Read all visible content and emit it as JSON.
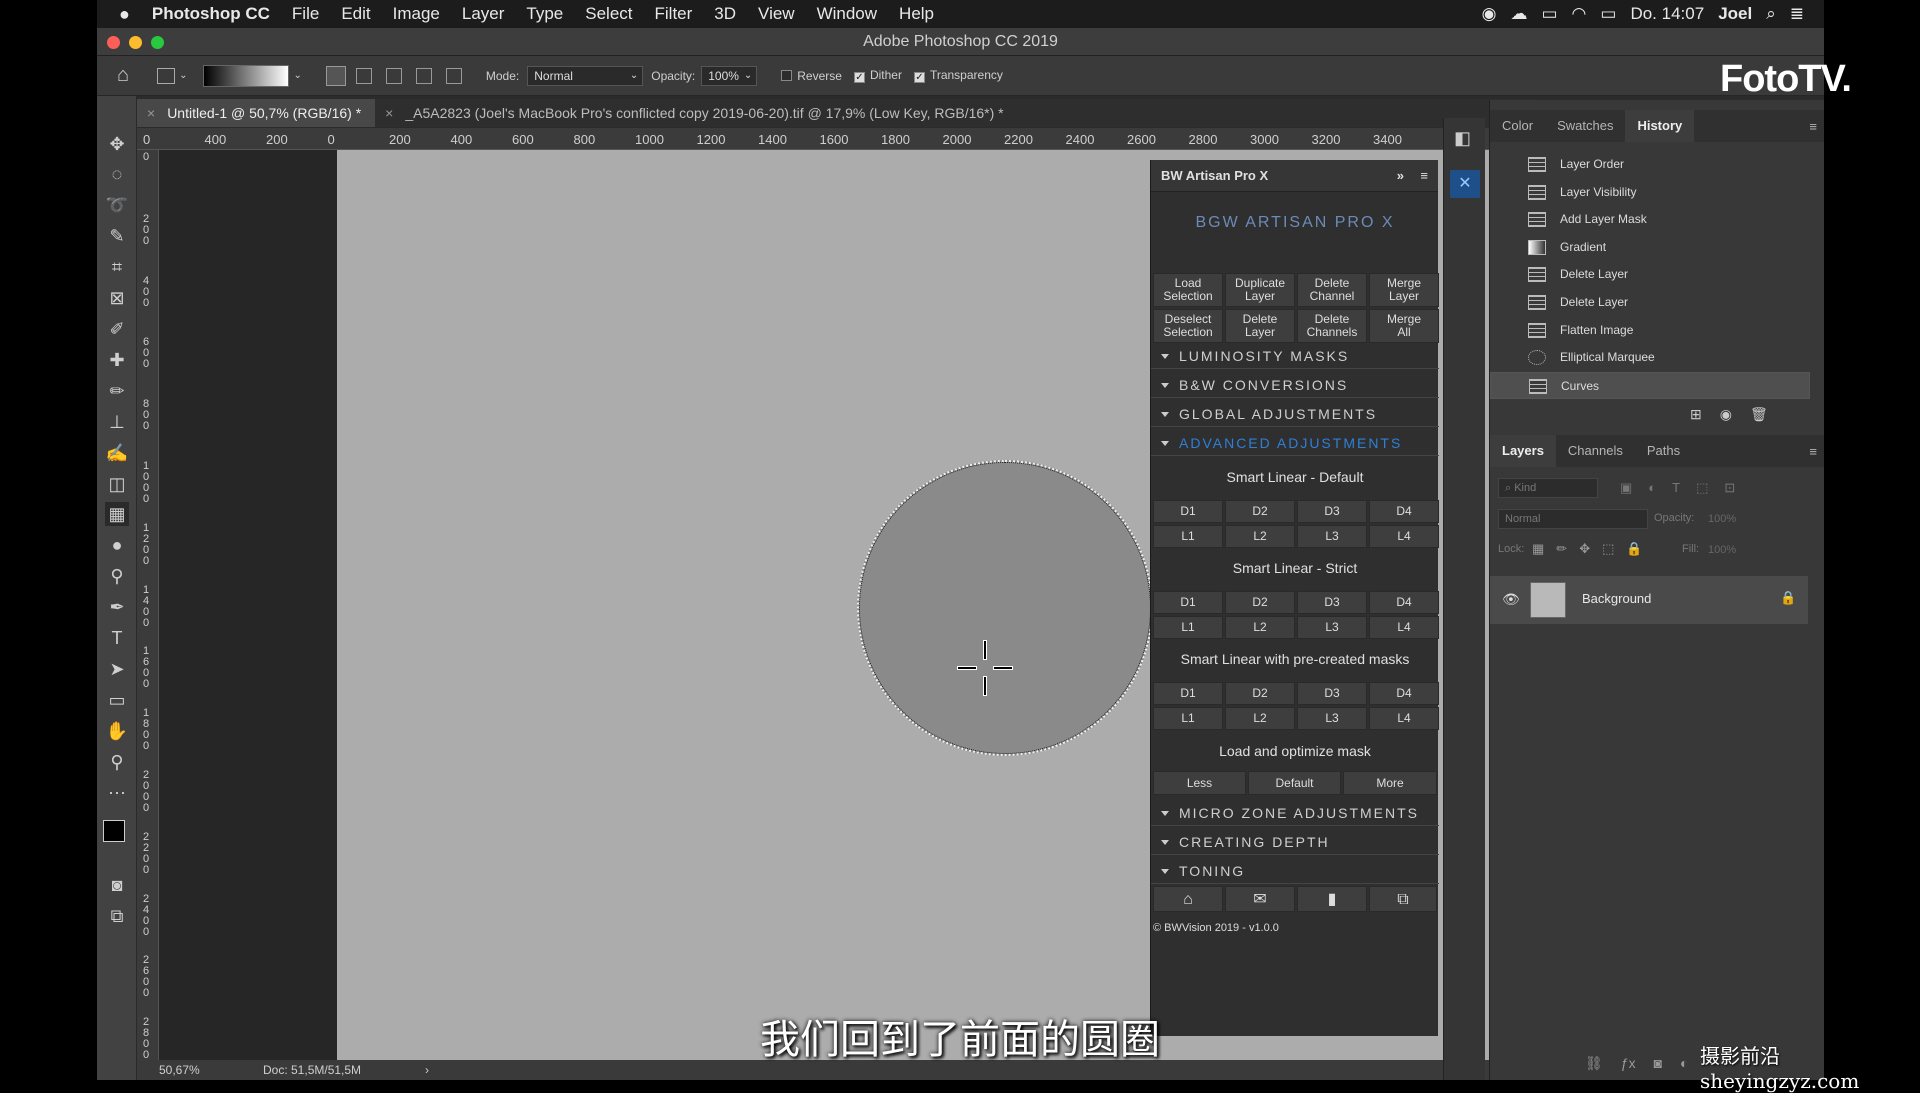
{
  "menubar": {
    "apple": "",
    "app": "Photoshop CC",
    "items": [
      "File",
      "Edit",
      "Image",
      "Layer",
      "Type",
      "Select",
      "Filter",
      "3D",
      "View",
      "Window",
      "Help"
    ],
    "clock": "Do. 14:07",
    "user": "Joel"
  },
  "window_title": "Adobe Photoshop CC 2019",
  "options": {
    "mode_label": "Mode:",
    "mode_value": "Normal",
    "opacity_label": "Opacity:",
    "opacity_value": "100%",
    "reverse_label": "Reverse",
    "reverse_checked": false,
    "dither_label": "Dither",
    "dither_checked": true,
    "transparency_label": "Transparency",
    "transparency_checked": true
  },
  "doc_tabs": [
    {
      "label": "Untitled-1 @ 50,7% (RGB/16) *",
      "active": true
    },
    {
      "label": "_A5A2823 (Joel's MacBook Pro's conflicted copy 2019-06-20).tif @ 17,9% (Low Key, RGB/16*) *",
      "active": false
    }
  ],
  "ruler_h": [
    "0",
    "400",
    "200",
    "0",
    "200",
    "400",
    "600",
    "800",
    "1000",
    "1200",
    "1400",
    "1600",
    "1800",
    "2000",
    "2200",
    "2400",
    "2600",
    "2800",
    "3000",
    "3200",
    "3400"
  ],
  "ruler_v": [
    "0",
    "2 0 0",
    "4 0 0",
    "6 0 0",
    "8 0 0",
    "1 0 0 0",
    "1 2 0 0",
    "1 4 0 0",
    "1 6 0 0",
    "1 8 0 0",
    "2 0 0 0",
    "2 2 0 0",
    "2 4 0 0",
    "2 6 0 0",
    "2 8 0 0"
  ],
  "status": {
    "zoom": "50,67%",
    "doc": "Doc: 51,5M/51,5M",
    "arrow": "›"
  },
  "bw_panel": {
    "title": "BW Artisan Pro X",
    "logo_text": "BGW ARTISAN PRO X",
    "top_buttons": [
      [
        "Load\nSelection",
        "Duplicate\nLayer",
        "Delete\nChannel",
        "Merge\nLayer"
      ],
      [
        "Deselect\nSelection",
        "Delete\nLayer",
        "Delete\nChannels",
        "Merge\nAll"
      ]
    ],
    "sections": [
      "LUMINOSITY MASKS",
      "B&W CONVERSIONS",
      "GLOBAL ADJUSTMENTS",
      "ADVANCED ADJUSTMENTS"
    ],
    "sub1": "Smart Linear - Default",
    "sub2": "Smart Linear - Strict",
    "sub3": "Smart Linear with pre-created masks",
    "d_row": [
      "D1",
      "D2",
      "D3",
      "D4"
    ],
    "l_row": [
      "L1",
      "L2",
      "L3",
      "L4"
    ],
    "sub4": "Load and optimize mask",
    "mask_buttons": [
      "Less",
      "Default",
      "More"
    ],
    "sections2": [
      "MICRO ZONE ADJUSTMENTS",
      "CREATING DEPTH",
      "TONING"
    ],
    "copyright": "© BWVision 2019 - v1.0.0",
    "accent": "#2f7fd8"
  },
  "right_panel": {
    "tabs_top": [
      "Color",
      "Swatches",
      "History"
    ],
    "history": [
      "Layer Order",
      "Layer Visibility",
      "Add Layer Mask",
      "Gradient",
      "Delete Layer",
      "Delete Layer",
      "Flatten Image",
      "Elliptical Marquee",
      "Curves"
    ],
    "tabs_layers": [
      "Layers",
      "Channels",
      "Paths"
    ],
    "kind_placeholder": "Kind",
    "blend_mode": "Normal",
    "opacity_label": "Opacity:",
    "opacity_value": "100%",
    "lock_label": "Lock:",
    "fill_label": "Fill:",
    "fill_value": "100%",
    "layer_name": "Background"
  },
  "watermark_logo": "FotoTV.",
  "subtitle": "我们回到了前面的圆圈",
  "site_watermark": "摄影前沿 sheyingzyz.com"
}
